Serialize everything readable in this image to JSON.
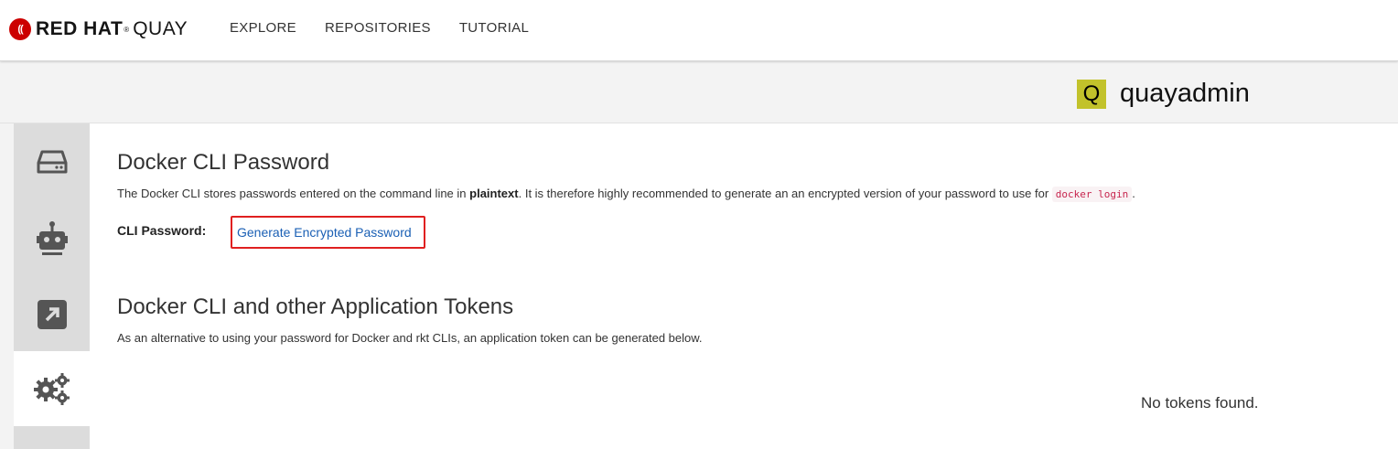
{
  "brand": {
    "mark": "((",
    "red": "RED HAT",
    "reg": "®",
    "product": "QUAY"
  },
  "nav": {
    "items": [
      "EXPLORE",
      "REPOSITORIES",
      "TUTORIAL"
    ]
  },
  "user": {
    "avatar_letter": "Q",
    "name": "quayadmin",
    "avatar_color": "#c2c22b"
  },
  "sidebar": {
    "items": [
      {
        "icon": "hard-drive-icon",
        "active": false
      },
      {
        "icon": "robot-icon",
        "active": false
      },
      {
        "icon": "external-link-icon",
        "active": false
      },
      {
        "icon": "gears-icon",
        "active": true
      }
    ]
  },
  "password_section": {
    "title": "Docker CLI Password",
    "desc_before": "The Docker CLI stores passwords entered on the command line in ",
    "desc_bold": "plaintext",
    "desc_after": ". It is therefore highly recommended to generate an an encrypted version of your password to use for ",
    "desc_code": "docker login",
    "desc_end": ".",
    "label": "CLI Password:",
    "link": "Generate Encrypted Password"
  },
  "tokens_section": {
    "title": "Docker CLI and other Application Tokens",
    "desc": "As an alternative to using your password for Docker and rkt CLIs, an application token can be generated below.",
    "empty": "No tokens found."
  },
  "colors": {
    "highlight_box": "#e02020",
    "link": "#1a5fb4",
    "code": "#c7254e"
  }
}
